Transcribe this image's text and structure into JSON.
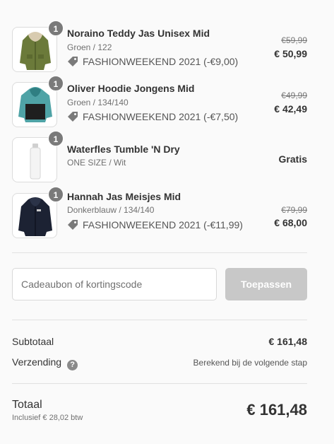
{
  "items": [
    {
      "name": "Noraino Teddy Jas Unisex Mid",
      "variant": "Groen / 122",
      "quantity": "1",
      "discount": "FASHIONWEEKEND 2021 (-€9,00)",
      "old_price": "€59,99",
      "price": "€ 50,99",
      "image": "green-parka-jacket"
    },
    {
      "name": "Oliver Hoodie Jongens Mid",
      "variant": "Groen / 134/140",
      "quantity": "1",
      "discount": "FASHIONWEEKEND 2021 (-€7,50)",
      "old_price": "€49,99",
      "price": "€ 42,49",
      "image": "teal-black-hoodie"
    },
    {
      "name": "Waterfles Tumble 'N Dry",
      "variant": "ONE SIZE / Wit",
      "quantity": "1",
      "price": "Gratis",
      "image": "white-water-bottle"
    },
    {
      "name": "Hannah Jas Meisjes Mid",
      "variant": "Donkerblauw / 134/140",
      "quantity": "1",
      "discount": "FASHIONWEEKEND 2021 (-€11,99)",
      "old_price": "€79,99",
      "price": "€ 68,00",
      "image": "navy-fleece-jacket"
    }
  ],
  "discount_code": {
    "placeholder": "Cadeaubon of kortingscode",
    "value": "",
    "apply_label": "Toepassen"
  },
  "summary": {
    "subtotal_label": "Subtotaal",
    "subtotal_value": "€ 161,48",
    "shipping_label": "Verzending",
    "shipping_value": "Berekend bij de volgende stap",
    "help_icon": "?"
  },
  "total": {
    "label": "Totaal",
    "tax_line": "Inclusief € 28,02 btw",
    "value": "€ 161,48"
  },
  "colors": {
    "background": "#fafafa",
    "button_disabled": "#c8c8c8",
    "badge": "#7a7a7a"
  }
}
